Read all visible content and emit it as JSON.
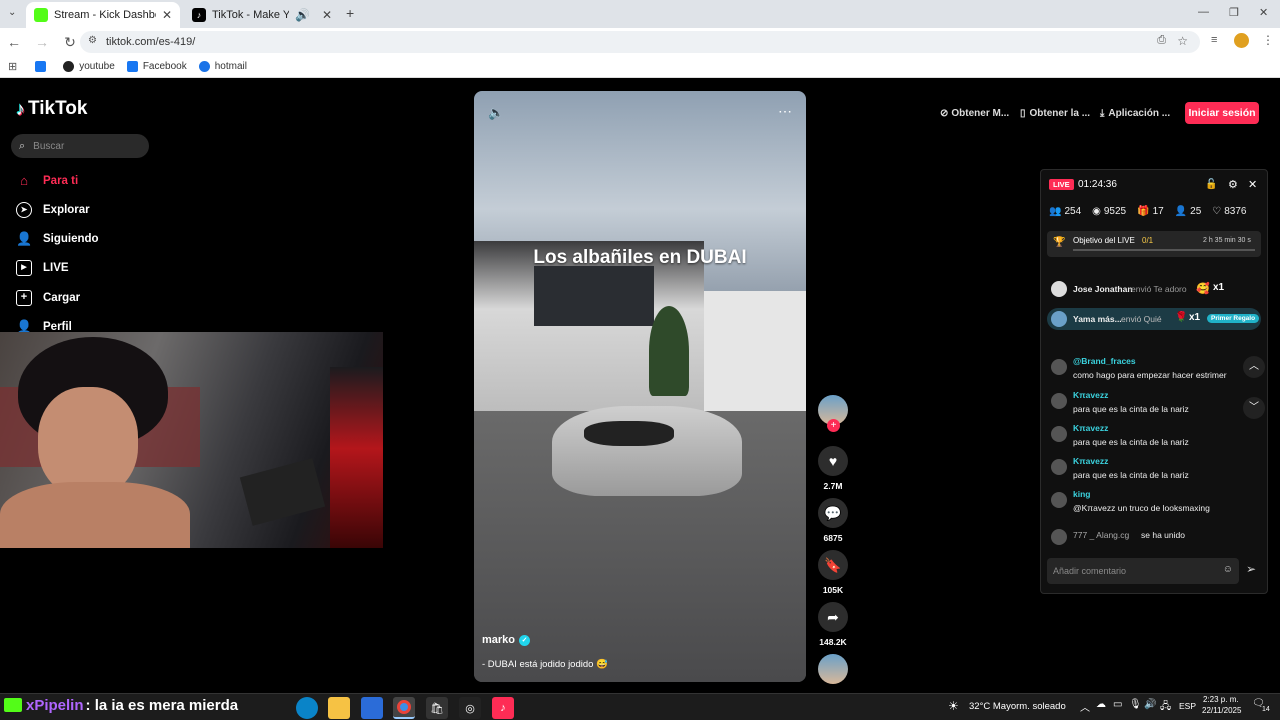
{
  "browser": {
    "tabs": [
      {
        "title": "Stream - Kick Dashboard",
        "icon": "kick-icon",
        "color": "#53fc18"
      },
      {
        "title": "TikTok - Make Your Day",
        "icon": "tiktok-icon",
        "color": "#000000"
      }
    ],
    "new_tab": "+",
    "url": "tiktok.com/es-419/",
    "bookmarks": [
      {
        "label": "",
        "icon": "facebook-icon"
      },
      {
        "label": "youtube",
        "icon": "github-icon"
      },
      {
        "label": "Facebook",
        "icon": "facebook-icon"
      },
      {
        "label": "hotmail",
        "icon": "msn-icon"
      }
    ]
  },
  "tiktok": {
    "brand": "TikTok",
    "search_placeholder": "Buscar",
    "nav": [
      {
        "label": "Para ti",
        "icon": "home-icon",
        "active": true
      },
      {
        "label": "Explorar",
        "icon": "compass-icon"
      },
      {
        "label": "Siguiendo",
        "icon": "following-icon"
      },
      {
        "label": "LIVE",
        "icon": "live-tv-icon"
      },
      {
        "label": "Cargar",
        "icon": "upload-icon"
      },
      {
        "label": "Perfil",
        "icon": "profile-icon"
      }
    ],
    "top_actions": [
      {
        "label": "Obtener M...",
        "icon": "coin-icon"
      },
      {
        "label": "Obtener la ...",
        "icon": "phone-icon"
      },
      {
        "label": "Aplicación ...",
        "icon": "download-icon"
      }
    ],
    "login": "Iniciar sesión",
    "accent": "#fe2c55",
    "video": {
      "caption": "Los albañiles en DUBAI",
      "author": "marko",
      "description": "- DUBAI está jodido jodido 😅",
      "likes": "2.7M",
      "comments": "6875",
      "saves": "105K",
      "shares": "148.2K"
    }
  },
  "live_panel": {
    "badge": "LIVE",
    "timer": "01:24:36",
    "stats": [
      {
        "icon": "users-icon",
        "value": "254"
      },
      {
        "icon": "eye-icon",
        "value": "9525"
      },
      {
        "icon": "gift-icon",
        "value": "17"
      },
      {
        "icon": "user-plus-icon",
        "value": "25"
      },
      {
        "icon": "heart-icon",
        "value": "8376"
      }
    ],
    "goal": {
      "label": "Objetivo del LIVE",
      "progress": "0/1",
      "time": "2 h 35 min 30 s"
    },
    "gifts": [
      {
        "user": "Jose Jonathan",
        "text": "envió Te adoro",
        "count": "x1"
      },
      {
        "user": "Yama más...",
        "text": "envió Quié",
        "count": "x1",
        "tag": "Primer Regalo"
      }
    ],
    "messages": [
      {
        "user": "@Brand_fraces",
        "text": "como hago para empezar hacer estrimer"
      },
      {
        "user": "Kπavezz",
        "text": "para que es la cinta de la nariz"
      },
      {
        "user": "Kπavezz",
        "text": "para que es la cinta de la nariz"
      },
      {
        "user": "Kπavezz",
        "text": "para que es la cinta de la nariz"
      },
      {
        "user": "king",
        "text": "@Kπavezz un truco de looksmaxing"
      }
    ],
    "join": {
      "user": "777 _ Alang.cg",
      "text": "se ha unido"
    },
    "comment_placeholder": "Añadir comentario"
  },
  "overlay": {
    "user": "xPipelin",
    "text": ": la ia es mera mierda"
  },
  "taskbar": {
    "weather": "32°C  Mayorm. soleado",
    "lang": "ESP",
    "time": "2:23 p. m.",
    "date": "22/11/2025",
    "notif": "14"
  }
}
